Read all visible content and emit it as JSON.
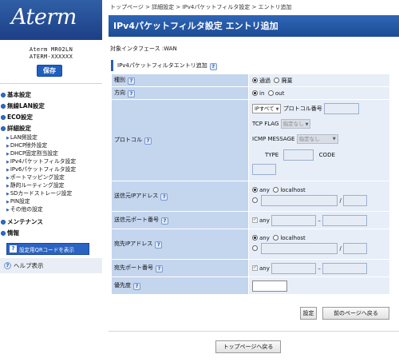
{
  "sidebar": {
    "logo": "Aterm",
    "model_line1": "Aterm MR02LN",
    "model_line2": "ATERM-XXXXXX",
    "save_label": "保存",
    "menu": {
      "basic": "基本設定",
      "wireless": "無線LAN設定",
      "eco": "ECO設定",
      "detail": "詳細設定",
      "detail_items": [
        "LAN側設定",
        "DHCP除外設定",
        "DHCP固定割当設定",
        "IPv4パケットフィルタ設定",
        "IPv6パケットフィルタ設定",
        "ポートマッピング設定",
        "静的ルーティング設定",
        "SDカードストレージ設定",
        "PIN設定",
        "その他の設定"
      ],
      "maintenance": "メンテナンス",
      "info": "情報"
    },
    "qr_label": "設定用QRコードを表示",
    "help_label": "ヘルプ表示"
  },
  "header": {
    "breadcrumb": "トップページ > 詳細設定 > IPv4パケットフィルタ設定 > エントリ追加",
    "title": "IPv4パケットフィルタ設定 エントリ追加",
    "interface": "対象インタフェース :WAN",
    "section": "IPv4パケットフィルタエントリ追加"
  },
  "form": {
    "type": {
      "label": "種別",
      "opt1": "通過",
      "opt2": "廃棄"
    },
    "direction": {
      "label": "方向",
      "opt1": "in",
      "opt2": "out"
    },
    "protocol": {
      "label": "プロトコル",
      "select": "IPすべて",
      "number_label": "プロトコル番号",
      "tcp_flag_label": "TCP FLAG",
      "tcp_flag_value": "指定なし",
      "icmp_label": "ICMP MESSAGE",
      "icmp_value": "指定なし",
      "type_label": "TYPE",
      "code_label": "CODE"
    },
    "src_ip": {
      "label": "送信元IPアドレス",
      "any": "any",
      "localhost": "localhost",
      "slash": "/"
    },
    "src_port": {
      "label": "送信元ポート番号",
      "any": "any",
      "dash": "–"
    },
    "dst_ip": {
      "label": "宛先IPアドレス",
      "any": "any",
      "localhost": "localhost",
      "slash": "/"
    },
    "dst_port": {
      "label": "宛先ポート番号",
      "any": "any",
      "dash": "–"
    },
    "priority": {
      "label": "優先度"
    }
  },
  "buttons": {
    "set": "設定",
    "prev": "前のページへ戻る",
    "top": "トップページへ戻る"
  },
  "colors": {
    "accent": "#1c4c96",
    "label_bg": "#c4d5ee",
    "value_bg": "#e7eef8"
  }
}
